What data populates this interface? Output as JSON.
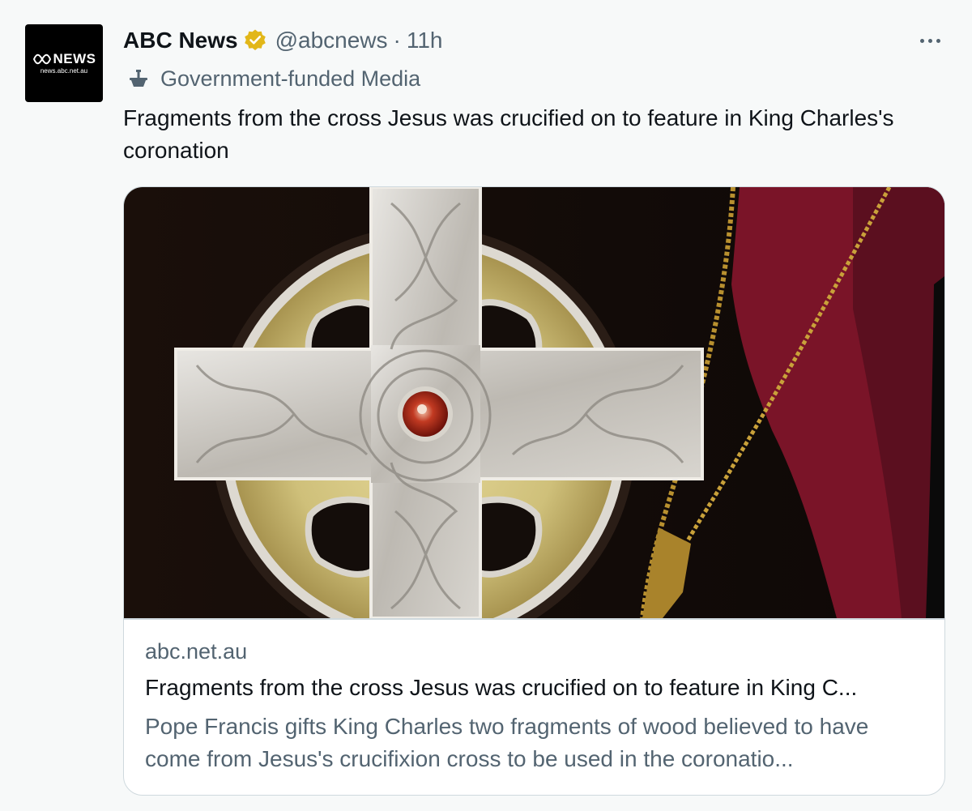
{
  "avatar": {
    "logo_text": "NEWS",
    "url_text": "news.abc.net.au"
  },
  "author": {
    "display_name": "ABC News",
    "handle": "@abcnews",
    "separator": "·",
    "time": "11h",
    "verified_badge_color": "#e2b719"
  },
  "label": {
    "text": "Government-funded Media",
    "icon": "government-building-icon"
  },
  "tweet": {
    "text": "Fragments from the cross Jesus was crucified on to feature in King Charles's coronation"
  },
  "card": {
    "domain": "abc.net.au",
    "title": "Fragments from the cross Jesus was crucified on to feature in King C...",
    "description": "Pope Francis gifts King Charles two fragments of wood believed to have come from Jesus's crucifixion cross to be used in the coronatio..."
  },
  "colors": {
    "background": "#f7f9f9",
    "text_primary": "#0f1419",
    "text_secondary": "#536471",
    "border": "#cfd9de"
  }
}
